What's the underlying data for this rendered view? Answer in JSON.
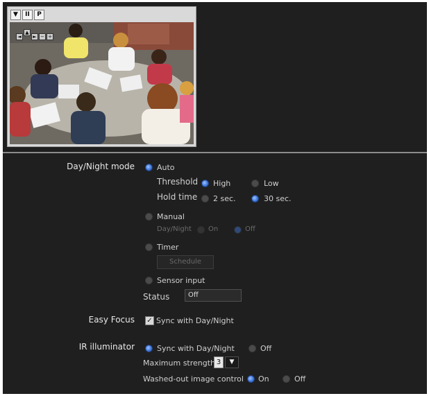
{
  "viewer": {
    "buttons": [
      "▼",
      "II",
      "P"
    ],
    "ptz_controls": [
      "◄",
      "▲",
      "►",
      "−",
      "+"
    ]
  },
  "day_night": {
    "label": "Day/Night mode",
    "auto": "Auto",
    "threshold_label": "Threshold",
    "threshold_high": "High",
    "threshold_low": "Low",
    "hold_label": "Hold time",
    "hold_2": "2 sec.",
    "hold_30": "30 sec.",
    "manual": "Manual",
    "manual_sub_label": "Day/Night",
    "manual_on": "On",
    "manual_off": "Off",
    "timer": "Timer",
    "schedule_button": "Schedule",
    "sensor": "Sensor input",
    "status_label": "Status",
    "status_value": "Off"
  },
  "easy_focus": {
    "label": "Easy Focus",
    "checkbox_label": "Sync with Day/Night",
    "checked": true
  },
  "ir": {
    "label": "IR illuminator",
    "sync": "Sync with Day/Night",
    "off": "Off",
    "max_strength_label": "Maximum strength",
    "max_strength_value": "3",
    "washed_label": "Washed-out image control",
    "washed_on": "On",
    "washed_off": "Off"
  },
  "colors": {
    "accent": "#3b72d8",
    "panel": "#1f1f1f"
  }
}
